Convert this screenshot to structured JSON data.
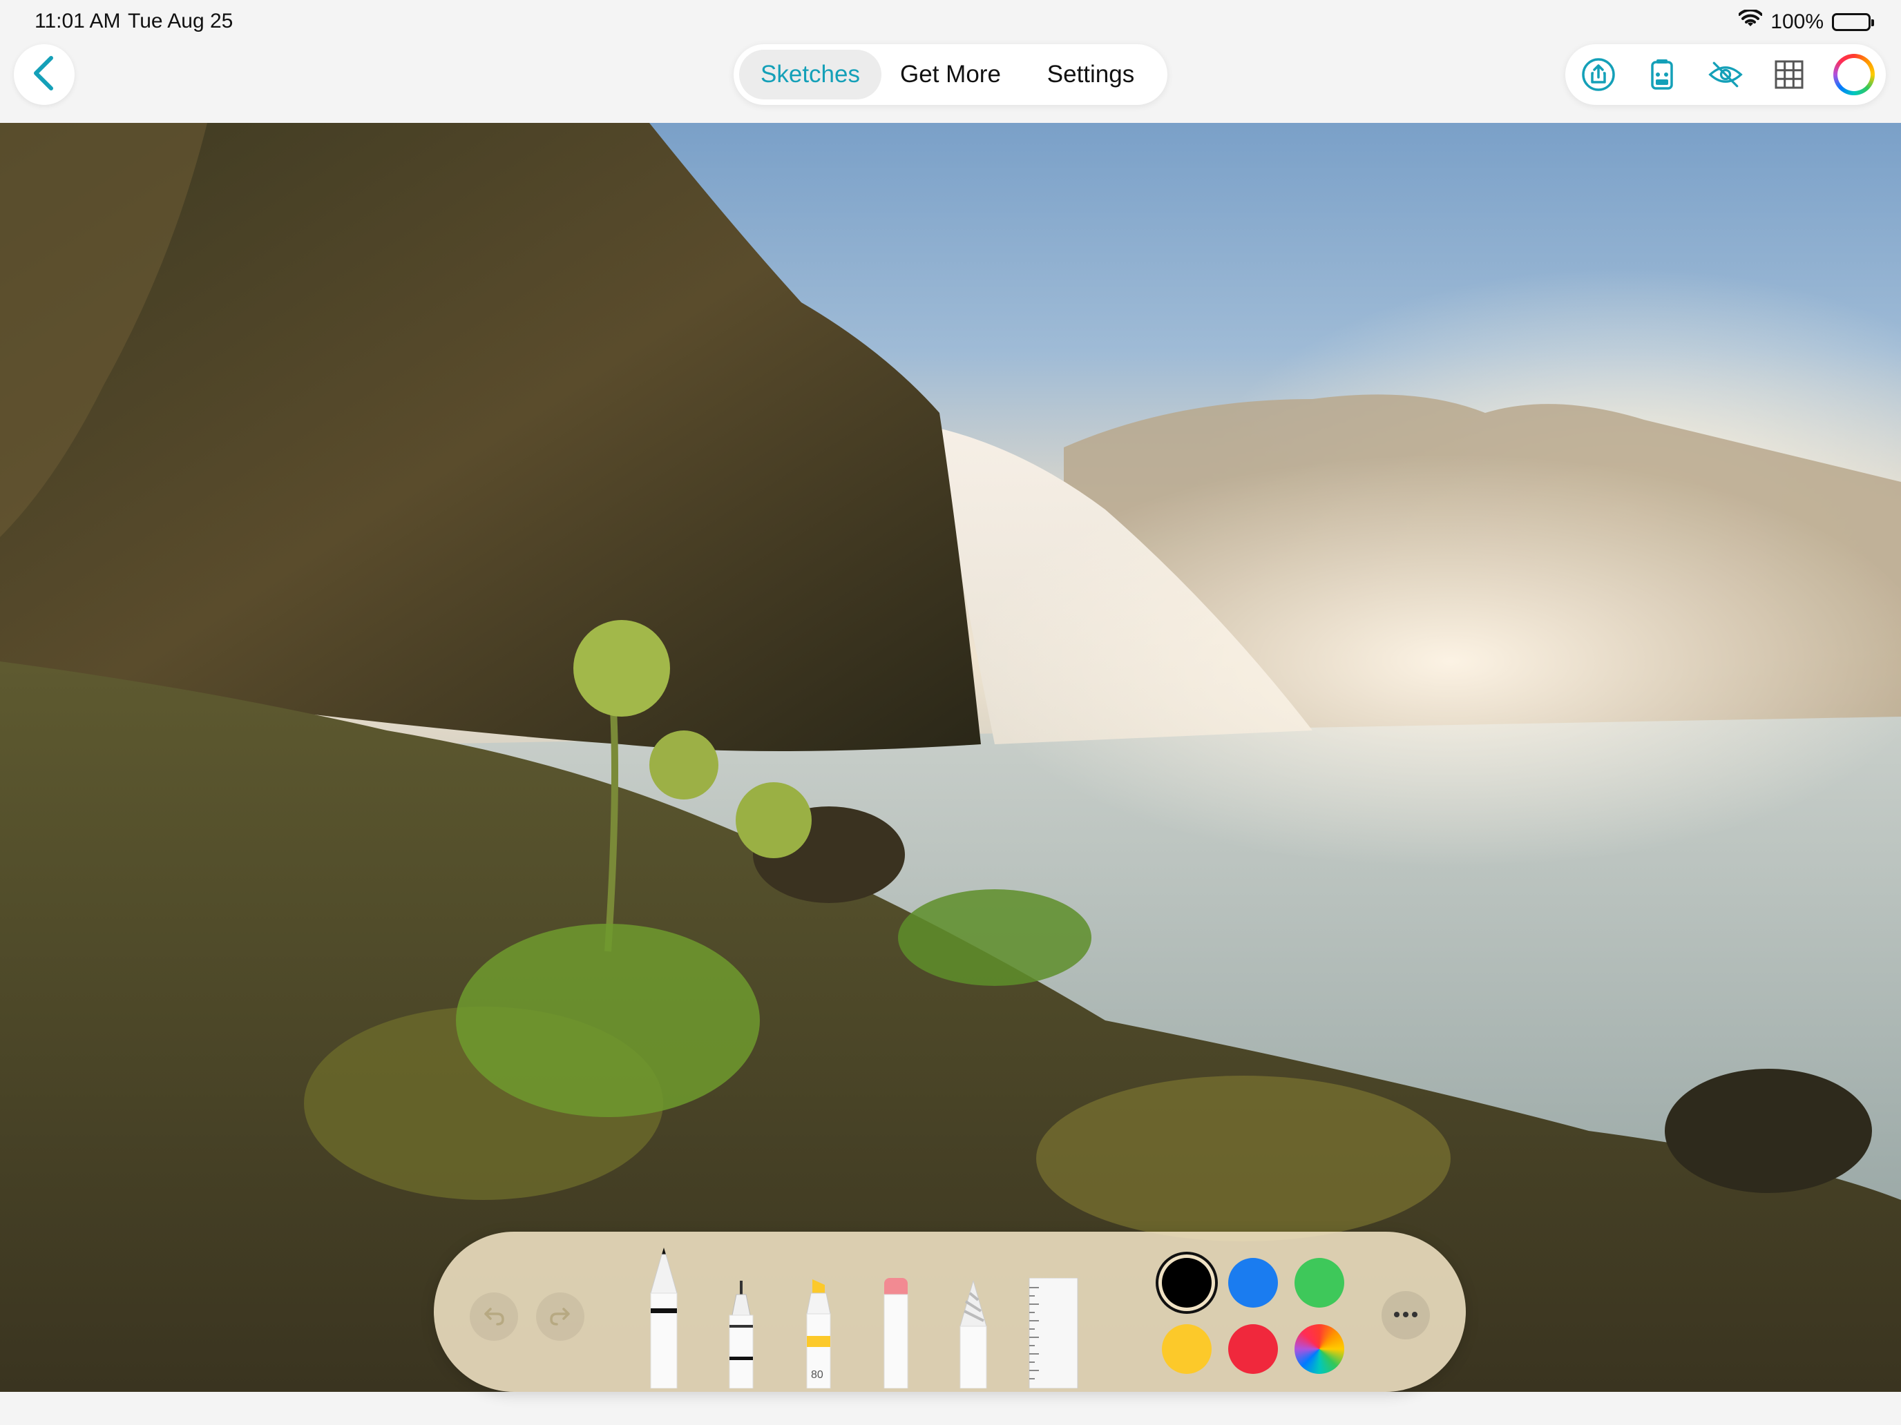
{
  "status_bar": {
    "time": "11:01 AM",
    "date": "Tue Aug 25",
    "battery_percent": "100%",
    "battery_level": 1.0
  },
  "nav": {
    "back_icon": "chevron-left-icon",
    "tabs": [
      {
        "label": "Sketches",
        "active": true
      },
      {
        "label": "Get More",
        "active": false
      },
      {
        "label": "Settings",
        "active": false
      }
    ],
    "accent_color": "#14a0b8"
  },
  "right_tools": [
    {
      "name": "share-icon"
    },
    {
      "name": "tracing-icon"
    },
    {
      "name": "hide-eye-icon"
    },
    {
      "name": "grid-icon"
    },
    {
      "name": "color-wheel-icon"
    }
  ],
  "toolbar": {
    "undo_icon": "undo-icon",
    "redo_icon": "redo-icon",
    "tools": [
      {
        "name": "pen-tool"
      },
      {
        "name": "fineliner-tool"
      },
      {
        "name": "marker-tool",
        "label": "80"
      },
      {
        "name": "eraser-tool"
      },
      {
        "name": "pencil-tool"
      },
      {
        "name": "ruler-tool"
      }
    ],
    "colors": [
      {
        "name": "black",
        "hex": "#000000",
        "selected": true
      },
      {
        "name": "blue",
        "hex": "#1a7cf0",
        "selected": false
      },
      {
        "name": "green",
        "hex": "#3ec85a",
        "selected": false
      },
      {
        "name": "yellow",
        "hex": "#fcc92a",
        "selected": false
      },
      {
        "name": "red",
        "hex": "#f0283c",
        "selected": false
      },
      {
        "name": "multicolor",
        "hex": "",
        "selected": false
      }
    ],
    "more_icon": "ellipsis-icon"
  }
}
